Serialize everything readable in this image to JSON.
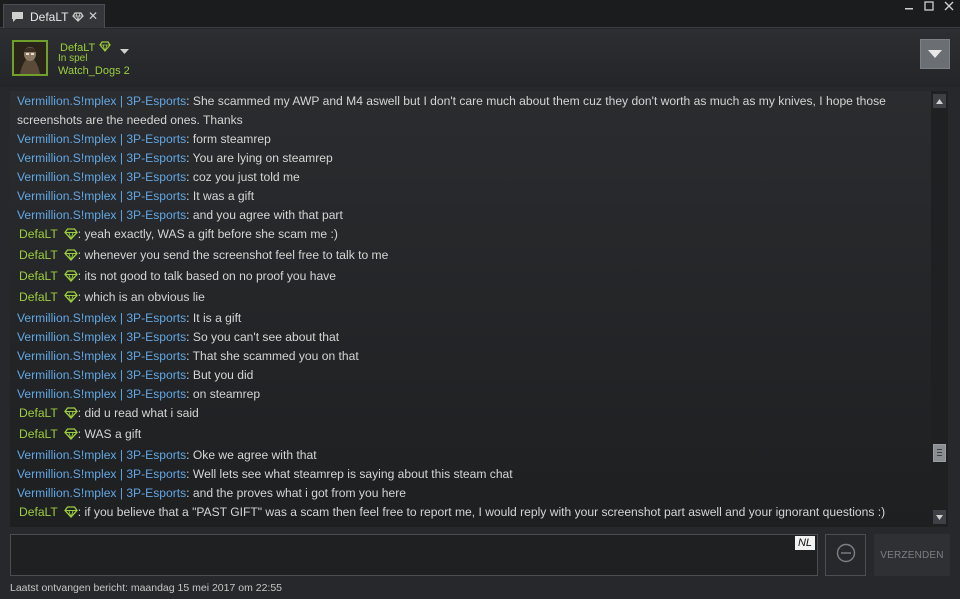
{
  "tab": {
    "title": "DefaLT",
    "close_label": "✕"
  },
  "window_controls": [
    "minimize",
    "maximize",
    "close"
  ],
  "friend": {
    "name": "DefaLT",
    "state": "In spel",
    "game": "Watch_Dogs 2"
  },
  "messages": [
    {
      "sender": "Vermillion.S!mplex | 3P-Esports",
      "type": "other",
      "text": "She scammed my AWP and M4 aswell but I don't care much about them cuz they don't worth as much as my knives, I hope those screenshots are the needed ones. Thanks"
    },
    {
      "sender": "Vermillion.S!mplex | 3P-Esports",
      "type": "other",
      "text": "form steamrep"
    },
    {
      "sender": "Vermillion.S!mplex | 3P-Esports",
      "type": "other",
      "text": "You are lying on steamrep"
    },
    {
      "sender": "Vermillion.S!mplex | 3P-Esports",
      "type": "other",
      "text": "coz you just told me"
    },
    {
      "sender": "Vermillion.S!mplex | 3P-Esports",
      "type": "other",
      "text": "It was a gift"
    },
    {
      "sender": "Vermillion.S!mplex | 3P-Esports",
      "type": "other",
      "text": "and you agree with that part"
    },
    {
      "sender": "DefaLT",
      "type": "own",
      "text": "yeah exactly, WAS a gift before she scam me :)"
    },
    {
      "sender": "DefaLT",
      "type": "own",
      "text": "whenever you send the screenshot feel free to talk to me"
    },
    {
      "sender": "DefaLT",
      "type": "own",
      "text": "its not good to talk based on no proof you have"
    },
    {
      "sender": "DefaLT",
      "type": "own",
      "text": "which is an obvious lie"
    },
    {
      "sender": "Vermillion.S!mplex | 3P-Esports",
      "type": "other",
      "text": "It is a gift"
    },
    {
      "sender": "Vermillion.S!mplex | 3P-Esports",
      "type": "other",
      "text": "So you can't see about that"
    },
    {
      "sender": "Vermillion.S!mplex | 3P-Esports",
      "type": "other",
      "text": "That she scammed you on that"
    },
    {
      "sender": "Vermillion.S!mplex | 3P-Esports",
      "type": "other",
      "text": "But you did"
    },
    {
      "sender": "Vermillion.S!mplex | 3P-Esports",
      "type": "other",
      "text": "on steamrep"
    },
    {
      "sender": "DefaLT",
      "type": "own",
      "text": "did u read what i said"
    },
    {
      "sender": "DefaLT",
      "type": "own",
      "text": "WAS a gift"
    },
    {
      "sender": "Vermillion.S!mplex | 3P-Esports",
      "type": "other",
      "text": "Oke we agree with that"
    },
    {
      "sender": "Vermillion.S!mplex | 3P-Esports",
      "type": "other",
      "text": "Well lets see what steamrep is saying about this steam chat"
    },
    {
      "sender": "Vermillion.S!mplex | 3P-Esports",
      "type": "other",
      "text": "and the proves what i got from you here"
    },
    {
      "sender": "DefaLT",
      "type": "own",
      "text": "if you believe that a \"PAST GIFT\" was a scam then feel free to report me, I would reply with your screenshot part aswell and your ignorant questions :)"
    }
  ],
  "input": {
    "value": "",
    "lang": "NL"
  },
  "send_label": "VERZENDEN",
  "status_line": "Laatst ontvangen bericht: maandag 15 mei 2017 om 22:55",
  "colors": {
    "sender_other": "#62a7e3",
    "sender_own": "#9ccf3c",
    "message_text": "#d5d5d5",
    "background": "#26282b"
  },
  "icons": {
    "tab": "chat-bubble-icon",
    "badge": "diamond-icon",
    "emoticon": "emoticon-icon",
    "menu": "chevron-down-icon"
  }
}
